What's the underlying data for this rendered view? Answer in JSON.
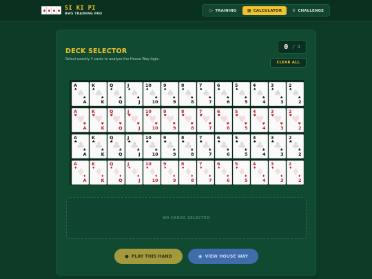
{
  "app": {
    "title": "SI KI PI",
    "subtitle": "RWS TRAINING PRO"
  },
  "nav": [
    {
      "label": "TRAINING",
      "icon": "play-icon",
      "glyph": "▷",
      "active": false
    },
    {
      "label": "CALCULATOR",
      "icon": "calculator-icon",
      "glyph": "▦",
      "active": true
    },
    {
      "label": "CHALLENGE",
      "icon": "trophy-icon",
      "glyph": "♕",
      "active": false
    }
  ],
  "panel": {
    "title": "DECK SELECTOR",
    "subtitle": "Select exactly 4 cards to analyze the House Way logic.",
    "counter": {
      "selected": "0",
      "separator": "/",
      "total": "4"
    },
    "clear_label": "CLEAR ALL",
    "empty_label": "NO CARDS SELECTED",
    "play_label": "PLAY THIS HAND",
    "house_label": "VIEW HOUSE WAY"
  },
  "deck": {
    "ranks": [
      "A",
      "K",
      "Q",
      "J",
      "10",
      "9",
      "8",
      "7",
      "6",
      "5",
      "4",
      "3",
      "2"
    ],
    "suits": [
      {
        "name": "spades",
        "symbol": "♠",
        "color": "black"
      },
      {
        "name": "hearts",
        "symbol": "♥",
        "color": "red"
      },
      {
        "name": "clubs",
        "symbol": "♣",
        "color": "black"
      },
      {
        "name": "diamonds",
        "symbol": "♦",
        "color": "red"
      }
    ]
  },
  "colors": {
    "accent": "#f2c12e",
    "background": "#0c3a26",
    "panel": "#104a31",
    "red_suit": "#c0192a",
    "play_button": "#a29a3c",
    "house_button": "#3f6cab"
  }
}
